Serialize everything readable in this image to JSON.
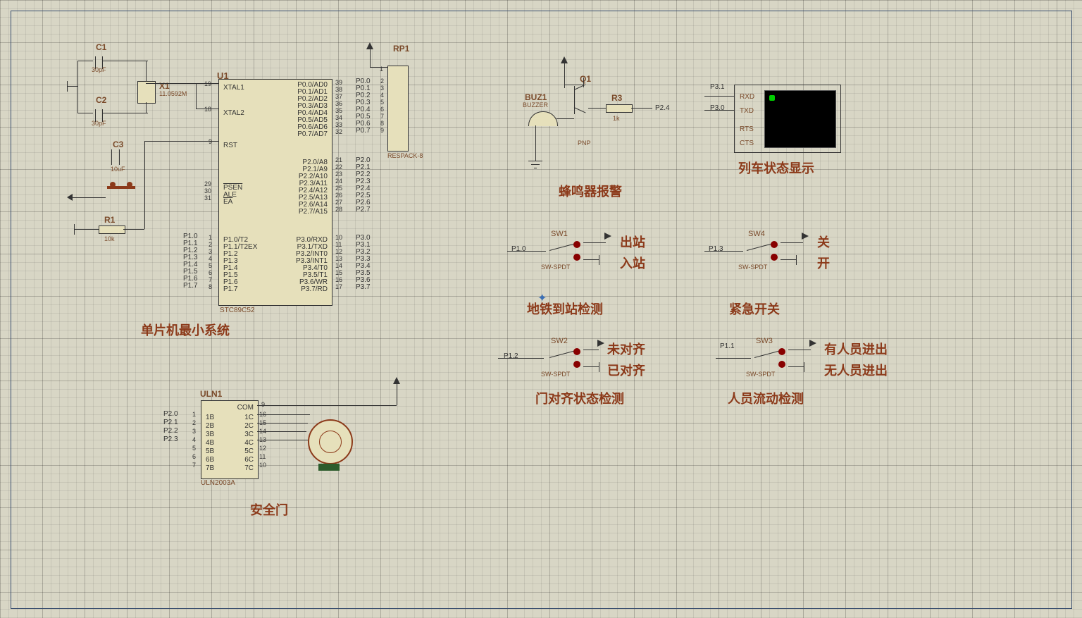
{
  "colors": {
    "accent": "#8c3a1a",
    "label": "#7a4a2a",
    "wire": "#333333",
    "chip_fill": "#e6e0bb"
  },
  "mcu": {
    "ref": "U1",
    "part": "STC89C52",
    "section_label": "单片机最小系统",
    "osc_pins": {
      "19": "XTAL1",
      "18": "XTAL2"
    },
    "rst_pin": {
      "9": "RST"
    },
    "ctrl_pins": {
      "29": "PSEN",
      "30": "ALE",
      "31": "EA"
    },
    "port0": {
      "39": "P0.0/AD0",
      "38": "P0.1/AD1",
      "37": "P0.2/AD2",
      "36": "P0.3/AD3",
      "35": "P0.4/AD4",
      "34": "P0.5/AD5",
      "33": "P0.6/AD6",
      "32": "P0.7/AD7"
    },
    "port0_nets": {
      "2": "P0.0",
      "3": "P0.1",
      "4": "P0.2",
      "5": "P0.3",
      "6": "P0.4",
      "7": "P0.5",
      "8": "P0.6",
      "9": "P0.7"
    },
    "port2": {
      "21": "P2.0/A8",
      "22": "P2.1/A9",
      "23": "P2.2/A10",
      "24": "P2.3/A11",
      "25": "P2.4/A12",
      "26": "P2.5/A13",
      "27": "P2.6/A14",
      "28": "P2.7/A15"
    },
    "port2_nets": [
      "P2.0",
      "P2.1",
      "P2.2",
      "P2.3",
      "P2.4",
      "P2.5",
      "P2.6",
      "P2.7"
    ],
    "port1_left": {
      "1": "P1.0",
      "2": "P1.1",
      "3": "P1.2",
      "4": "P1.3",
      "5": "P1.4",
      "6": "P1.5",
      "7": "P1.6",
      "8": "P1.7"
    },
    "port1_inner": [
      "P1.0/T2",
      "P1.1/T2EX",
      "P1.2",
      "P1.3",
      "P1.4",
      "P1.5",
      "P1.6",
      "P1.7"
    ],
    "port3": {
      "10": "P3.0/RXD",
      "11": "P3.1/TXD",
      "12": "P3.2/INT0",
      "13": "P3.3/INT1",
      "14": "P3.4/T0",
      "15": "P3.5/T1",
      "16": "P3.6/WR",
      "17": "P3.7/RD"
    },
    "port3_nets": [
      "P3.0",
      "P3.1",
      "P3.2",
      "P3.3",
      "P3.4",
      "P3.5",
      "P3.6",
      "P3.7"
    ]
  },
  "crystal": {
    "ref": "X1",
    "value": "11.0592M",
    "c1_ref": "C1",
    "c1_val": "30pF",
    "c2_ref": "C2",
    "c2_val": "30pF"
  },
  "reset": {
    "c_ref": "C3",
    "c_val": "10uF",
    "r_ref": "R1",
    "r_val": "10k"
  },
  "respack": {
    "ref": "RP1",
    "part": "RESPACK-8",
    "common_pin": "1"
  },
  "uln": {
    "ref": "ULN1",
    "part": "ULN2003A",
    "section_label": "安全门",
    "left_pins": {
      "1": "1B",
      "2": "2B",
      "3": "3B",
      "4": "4B",
      "5": "5B",
      "6": "6B",
      "7": "7B"
    },
    "right_pins": {
      "9": "COM",
      "16": "1C",
      "15": "2C",
      "14": "3C",
      "13": "4C",
      "12": "5C",
      "11": "6C",
      "10": "7C"
    },
    "in_nets": [
      "P2.0",
      "P2.1",
      "P2.2",
      "P2.3"
    ]
  },
  "buzzer": {
    "ref": "BUZ1",
    "part": "BUZZER",
    "q_ref": "Q1",
    "q_type": "PNP",
    "r_ref": "R3",
    "r_val": "1k",
    "net": "P2.4",
    "section_label": "蜂鸣器报警"
  },
  "display": {
    "section_label": "列车状态显示",
    "signals": [
      "RXD",
      "TXD",
      "RTS",
      "CTS"
    ],
    "in_nets": [
      "P3.1",
      "P3.0"
    ]
  },
  "switches": {
    "sw1": {
      "ref": "SW1",
      "part": "SW-SPDT",
      "net": "P1.0",
      "opt_a": "出站",
      "opt_b": "入站",
      "section": "地铁到站检测"
    },
    "sw2": {
      "ref": "SW2",
      "part": "SW-SPDT",
      "net": "P1.2",
      "opt_a": "未对齐",
      "opt_b": "已对齐",
      "section": "门对齐状态检测"
    },
    "sw3": {
      "ref": "SW3",
      "part": "SW-SPDT",
      "net": "P1.1",
      "opt_a": "有人员进出",
      "opt_b": "无人员进出",
      "section": "人员流动检测"
    },
    "sw4": {
      "ref": "SW4",
      "part": "SW-SPDT",
      "net": "P1.3",
      "opt_a": "关",
      "opt_b": "开",
      "section": "紧急开关"
    }
  }
}
